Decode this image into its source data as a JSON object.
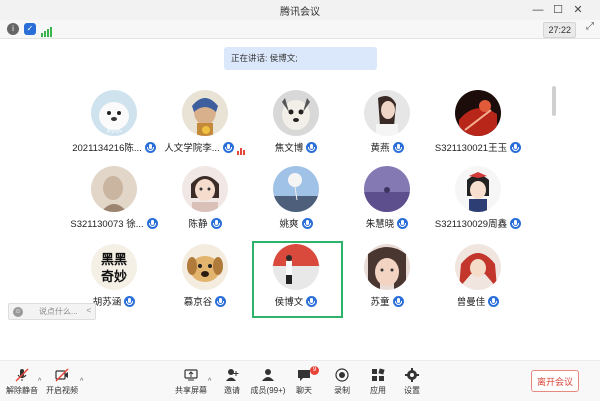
{
  "window": {
    "title": "腾讯会议"
  },
  "infobar": {
    "timer": "27:22"
  },
  "speaking": {
    "text": "正在讲话: 侯博文;"
  },
  "participants": [
    {
      "name": "2021134216陈...",
      "avatar": "white-dog-avatar"
    },
    {
      "name": "人文学院李...",
      "avatar": "painting-girl-avatar"
    },
    {
      "name": "焦文博",
      "avatar": "dog-avatar"
    },
    {
      "name": "黄燕",
      "avatar": "woman-photo-avatar"
    },
    {
      "name": "S321130021王玉",
      "avatar": "red-anime-avatar"
    },
    {
      "name": "S321130073 徐...",
      "avatar": "beige-photo-avatar"
    },
    {
      "name": "陈静",
      "avatar": "child-photo-avatar"
    },
    {
      "name": "姚爽",
      "avatar": "balloon-sky-avatar"
    },
    {
      "name": "朱慧晓",
      "avatar": "purple-photo-avatar"
    },
    {
      "name": "S321130029周鑫",
      "avatar": "anime-girl-avatar"
    },
    {
      "name": "胡苏涵",
      "avatar": "calligraphy-avatar"
    },
    {
      "name": "慕京谷",
      "avatar": "puppy-avatar"
    },
    {
      "name": "侯博文",
      "avatar": "stage-person-avatar"
    },
    {
      "name": "苏童",
      "avatar": "girl-selfie-avatar"
    },
    {
      "name": "曾曼佳",
      "avatar": "red-hair-anime-avatar"
    }
  ],
  "chat": {
    "placeholder": "说点什么...",
    "arrow": "<"
  },
  "toolbar": {
    "unmute": "解除静音",
    "start_video": "开启视频",
    "share_screen": "共享屏幕",
    "invite": "邀请",
    "members": "成员(99+)",
    "chat": "聊天",
    "chat_badge": "9",
    "record": "录制",
    "apps": "应用",
    "settings": "设置",
    "leave": "离开会议"
  },
  "colors": {
    "accent": "#2a6ed8",
    "active_speaker": "#2fb36b",
    "leave": "#d9463a"
  }
}
